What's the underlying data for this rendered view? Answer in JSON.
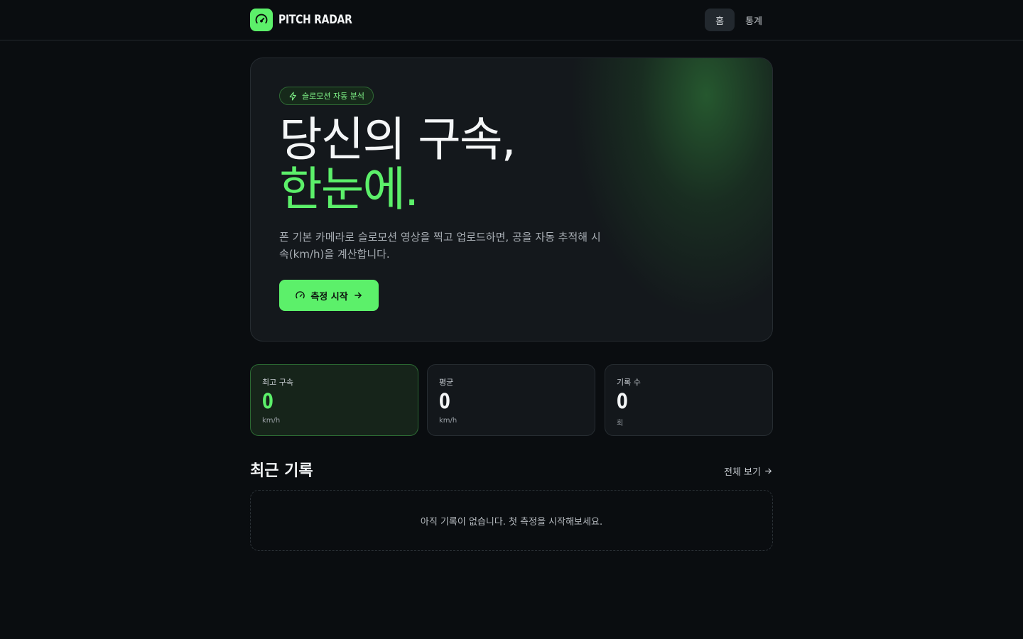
{
  "header": {
    "brand": "PITCH RADAR",
    "nav": [
      {
        "label": "홈",
        "active": true
      },
      {
        "label": "통계",
        "active": false
      }
    ]
  },
  "hero": {
    "badge": "슬로모션 자동 분석",
    "headline_line1": "당신의 구속,",
    "headline_line2": "한눈에.",
    "description": "폰 기본 카메라로 슬로모션 영상을 찍고 업로드하면, 공을 자동 추적해 시속(km/h)을 계산합니다.",
    "cta_label": "측정 시작"
  },
  "stats": [
    {
      "label": "최고 구속",
      "value": "0",
      "unit": "km/h"
    },
    {
      "label": "평균",
      "value": "0",
      "unit": "km/h"
    },
    {
      "label": "기록 수",
      "value": "0",
      "unit": "회"
    }
  ],
  "recent": {
    "title": "최근 기록",
    "see_all": "전체 보기",
    "empty_message": "아직 기록이 없습니다. 첫 측정을 시작해보세요."
  },
  "icons": {
    "logo": "speedometer-icon",
    "badge": "lightning-icon",
    "cta": "speedometer-icon",
    "cta_arrow": "arrow-right-icon",
    "see_all_arrow": "arrow-right-icon"
  },
  "colors": {
    "accent": "#5cf06a",
    "background": "#0a0d10",
    "card": "#14181c"
  }
}
